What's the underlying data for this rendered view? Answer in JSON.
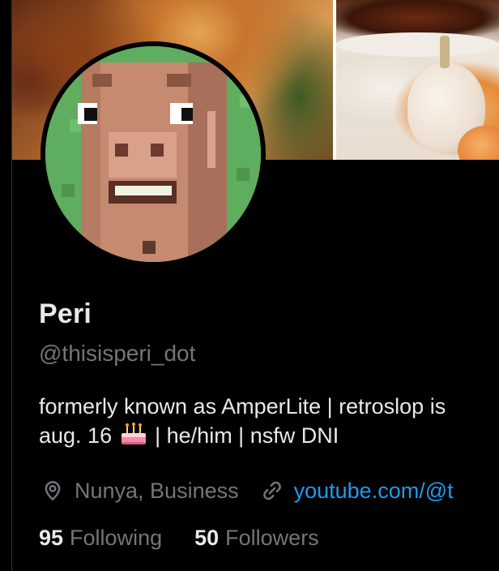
{
  "profile": {
    "display_name": "Peri",
    "handle": "@thisisperi_dot",
    "bio_line1": "formerly known as AmperLite | retroslop is",
    "bio_line2_prefix": "aug. 16",
    "bio_line2_suffix": "| he/him | nsfw DNI",
    "location": "Nunya, Business",
    "website": "youtube.com/@t"
  },
  "stats": {
    "following_count": "95",
    "following_label": "Following",
    "followers_count": "50",
    "followers_label": "Followers"
  },
  "icons": {
    "location": "location-pin-icon",
    "link": "link-icon",
    "birthday": "birthday-cake-emoji"
  },
  "colors": {
    "background": "#000000",
    "primary_text": "#e7e9ea",
    "secondary_text": "#71767b",
    "link": "#1d9bf0"
  }
}
